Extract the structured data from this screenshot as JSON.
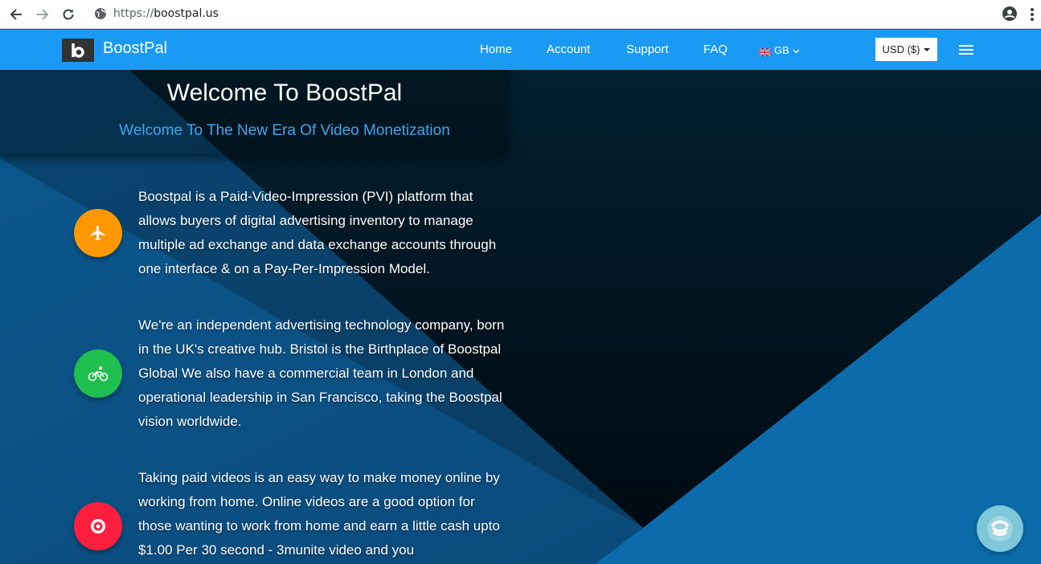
{
  "browser": {
    "url_scheme": "https://",
    "url_host": "boostpal.us",
    "icons": [
      "back-arrow-icon",
      "forward-arrow-icon",
      "reload-icon",
      "globe-icon",
      "account-circle-icon",
      "kebab-menu-icon"
    ]
  },
  "navbar": {
    "brand": "BoostPal",
    "links": [
      "Home",
      "Account",
      "Support",
      "FAQ"
    ],
    "language": "GB",
    "currency": "USD ($)",
    "colors": {
      "bar": "#1a9af5",
      "logo_bg": "#333333"
    }
  },
  "hero": {
    "title_prefix": "Welcome To",
    "title_brand": "BoostPal",
    "subtitle": "Welcome To The New Era Of Video Monetization",
    "features": [
      {
        "icon": "airplane-icon",
        "color": "#ff9800",
        "text": "Boostpal is a Paid-Video-Impression (PVI) platform that allows buyers of digital advertising inventory to manage multiple ad exchange and data exchange accounts through one interface & on a Pay-Per-Impression Model."
      },
      {
        "icon": "bicycle-icon",
        "color": "#1fbf4f",
        "text": "We're an independent advertising technology company, born in the UK's creative hub. Bristol is the Birthplace of Boostpal Global We also have a commercial team in London and operational leadership in San Francisco, taking the Boostpal vision worldwide."
      },
      {
        "icon": "target-icon",
        "color": "#ff1f3d",
        "text": "Taking paid videos is an easy way to make money online by working from home. Online videos are a good option for those wanting to work from home and earn a little cash upto $1.00 Per 30 second - 3munite video and you"
      }
    ]
  }
}
